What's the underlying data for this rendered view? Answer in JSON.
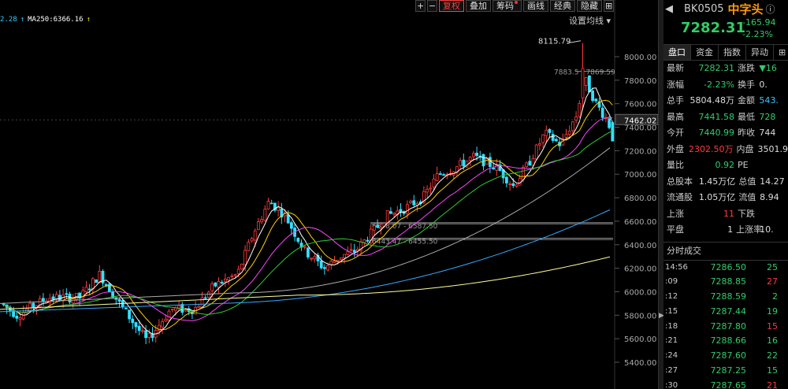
{
  "toolbar": {
    "buttons": [
      "+",
      "−",
      "复权",
      "叠加",
      "筹码",
      "画线",
      "经典",
      "隐藏",
      "⊞"
    ],
    "active": "复权"
  },
  "ma_legend": [
    {
      "text": "2.28",
      "color": "#33ccff"
    },
    {
      "text": "↑",
      "color": "#33ccff"
    },
    {
      "text": "MA250:6366.16",
      "color": "#ffffff"
    },
    {
      "text": "↑",
      "color": "#ffd000"
    }
  ],
  "settings_label": "设置均线",
  "price_labels": [
    "8000.00",
    "7800.00",
    "7600.00",
    "7400.00",
    "7200.00",
    "7000.00",
    "6800.00",
    "6600.00",
    "6400.00",
    "6200.00",
    "6000.00",
    "5800.00",
    "5600.00",
    "5400.00"
  ],
  "current_price_tag": "7462.02",
  "annotations": {
    "high": "8115.79",
    "gap_label": "7883.5 - 7869.59",
    "gap2_label": "6578.07 - 6587.50",
    "gap3_label": "6443.47 - 6455.50"
  },
  "chart_data": {
    "type": "candlestick",
    "ylim": [
      5250,
      8200
    ],
    "yticks": [
      8000,
      7800,
      7600,
      7400,
      7200,
      7000,
      6800,
      6600,
      6400,
      6200,
      6000,
      5800,
      5600,
      5400
    ],
    "high_point": 8115.79,
    "current": 7282.31,
    "colors": {
      "up": "#ff3b3b",
      "down": "#33e0ff",
      "ma5": "#ffffff",
      "ma10": "#ffd000",
      "ma20": "#ff44ff",
      "ma30": "#33cc33",
      "ma60": "#aaaaaa",
      "ma120": "#33aaff",
      "ma250": "#ffff99"
    }
  },
  "panel": {
    "code": "BK0505",
    "name": "中字头",
    "price": "7282.31",
    "change": "-165.94",
    "change_pct": "-2.23%",
    "tabs": [
      "盘口",
      "资金",
      "指数",
      "异动",
      "⊞"
    ],
    "active_tab": "盘口",
    "quote_rows": [
      {
        "l1": "最新",
        "v1": "7282.31",
        "c1": "green",
        "l2": "涨跌",
        "v2": "▼16",
        "c2": "green"
      },
      {
        "l1": "涨幅",
        "v1": "-2.23%",
        "c1": "green",
        "l2": "换手",
        "v2": "0.",
        "c2": "white"
      },
      {
        "l1": "总手",
        "v1": "5804.48万",
        "c1": "white",
        "l2": "金额",
        "v2": "543.",
        "c2": "cyan"
      },
      {
        "l1": "最高",
        "v1": "7441.58",
        "c1": "green",
        "l2": "最低",
        "v2": "728",
        "c2": "green"
      },
      {
        "l1": "今开",
        "v1": "7440.99",
        "c1": "green",
        "l2": "昨收",
        "v2": "744",
        "c2": "white"
      },
      {
        "l1": "外盘",
        "v1": "2302.50万",
        "c1": "red",
        "l2": "内盘",
        "v2": "3501.9",
        "c2": "white"
      },
      {
        "l1": "量比",
        "v1": "0.92",
        "c1": "green",
        "l2": "PE",
        "v2": "",
        "c2": "white"
      },
      {
        "l1": "总股本",
        "v1": "1.45万亿",
        "c1": "white",
        "l2": "总值",
        "v2": "14.27",
        "c2": "white"
      },
      {
        "l1": "流通股",
        "v1": "1.05万亿",
        "c1": "white",
        "l2": "流值",
        "v2": "8.94",
        "c2": "white"
      },
      {
        "l1": "上涨",
        "v1": "11",
        "c1": "red",
        "l2": "下跌",
        "v2": "",
        "c2": "white"
      },
      {
        "l1": "平盘",
        "v1": "1",
        "c1": "white",
        "l2": "上涨率",
        "v2": "10.",
        "c2": "white"
      }
    ],
    "ticks_title": "分时成交",
    "ticks": [
      {
        "t": "14:56",
        "p": "7286.50",
        "pc": "green",
        "v": "25",
        "vc": "green"
      },
      {
        "t": ":09",
        "p": "7288.85",
        "pc": "green",
        "v": "27",
        "vc": "red"
      },
      {
        "t": ":12",
        "p": "7288.59",
        "pc": "green",
        "v": "2",
        "vc": "green"
      },
      {
        "t": ":15",
        "p": "7287.44",
        "pc": "green",
        "v": "19",
        "vc": "green"
      },
      {
        "t": ":18",
        "p": "7287.80",
        "pc": "green",
        "v": "15",
        "vc": "red"
      },
      {
        "t": ":21",
        "p": "7288.66",
        "pc": "green",
        "v": "16",
        "vc": "green"
      },
      {
        "t": ":24",
        "p": "7287.60",
        "pc": "green",
        "v": "22",
        "vc": "green"
      },
      {
        "t": ":27",
        "p": "7287.25",
        "pc": "green",
        "v": "15",
        "vc": "green"
      },
      {
        "t": ":30",
        "p": "7287.65",
        "pc": "green",
        "v": "21",
        "vc": "red"
      }
    ]
  }
}
